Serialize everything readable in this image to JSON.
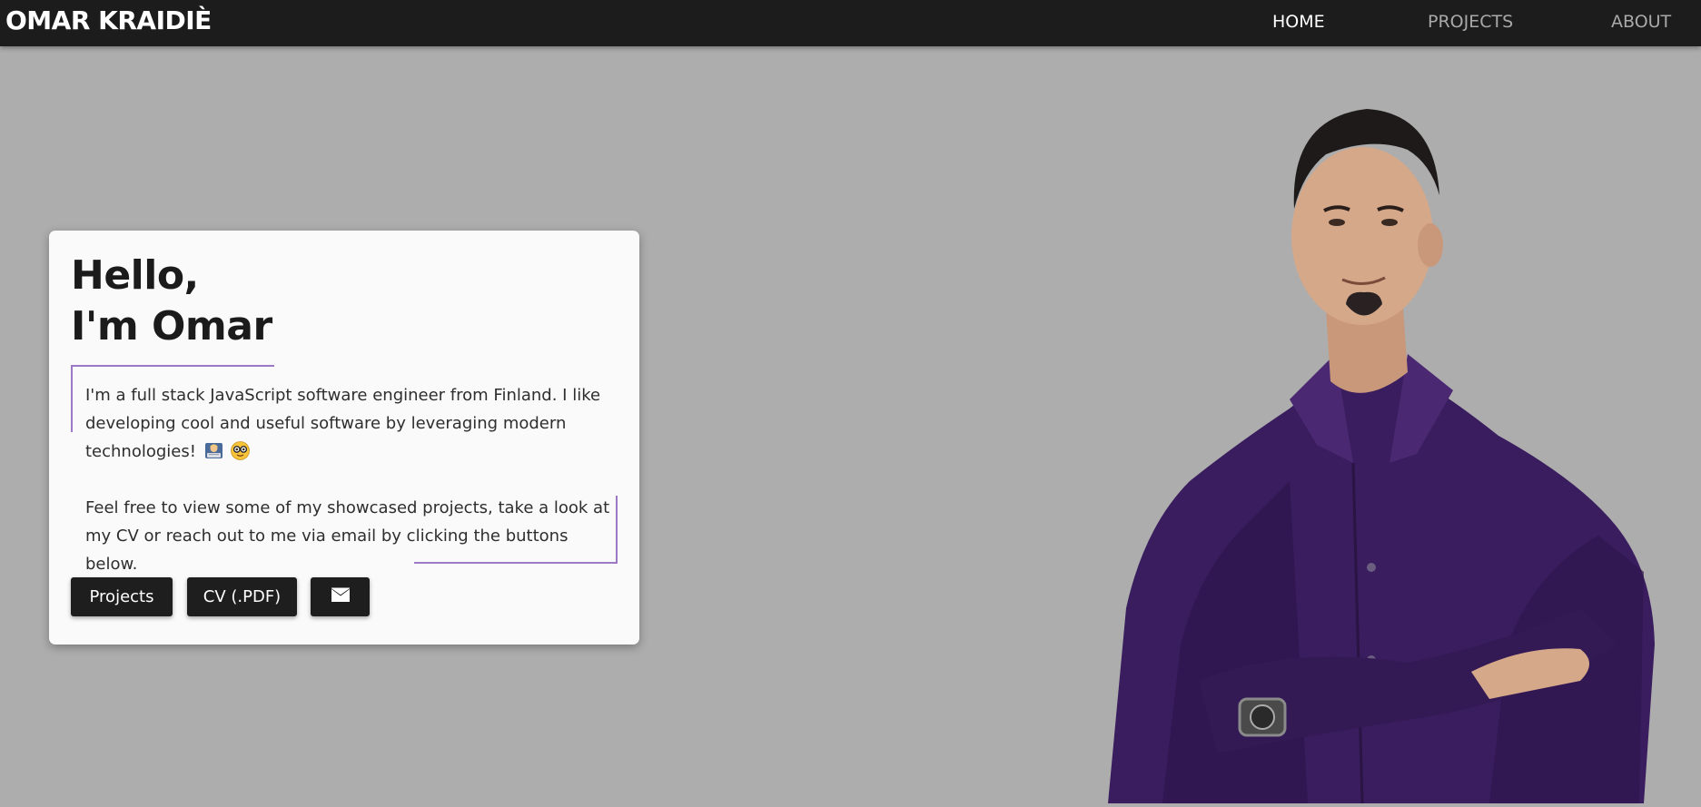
{
  "nav": {
    "brand": "OMAR KRAIDIÈ",
    "links": [
      {
        "label": "HOME",
        "active": true
      },
      {
        "label": "PROJECTS",
        "active": false
      },
      {
        "label": "ABOUT",
        "active": false
      }
    ]
  },
  "hero": {
    "heading_line1": "Hello,",
    "heading_line2": "I'm Omar",
    "intro": "I'm a full stack JavaScript software engineer from Finland. I like developing cool and useful software by leveraging modern technologies!",
    "intro_icons": [
      "programmer-emoji-icon",
      "nerd-face-emoji-icon"
    ],
    "cta": "Feel free to view some of my showcased projects, take a look at my CV or reach out to me via email by clicking the buttons below.",
    "buttons": {
      "projects": "Projects",
      "cv": "CV (.PDF)",
      "email_icon": "envelope-icon"
    }
  },
  "colors": {
    "background": "#adadad",
    "navbar": "#1c1c1c",
    "card": "#fafafa",
    "accent_line": "#9b79c4",
    "button": "#1e1e1e",
    "shirt": "#3a1d5e"
  },
  "photo": {
    "icon": "portrait-photo"
  }
}
